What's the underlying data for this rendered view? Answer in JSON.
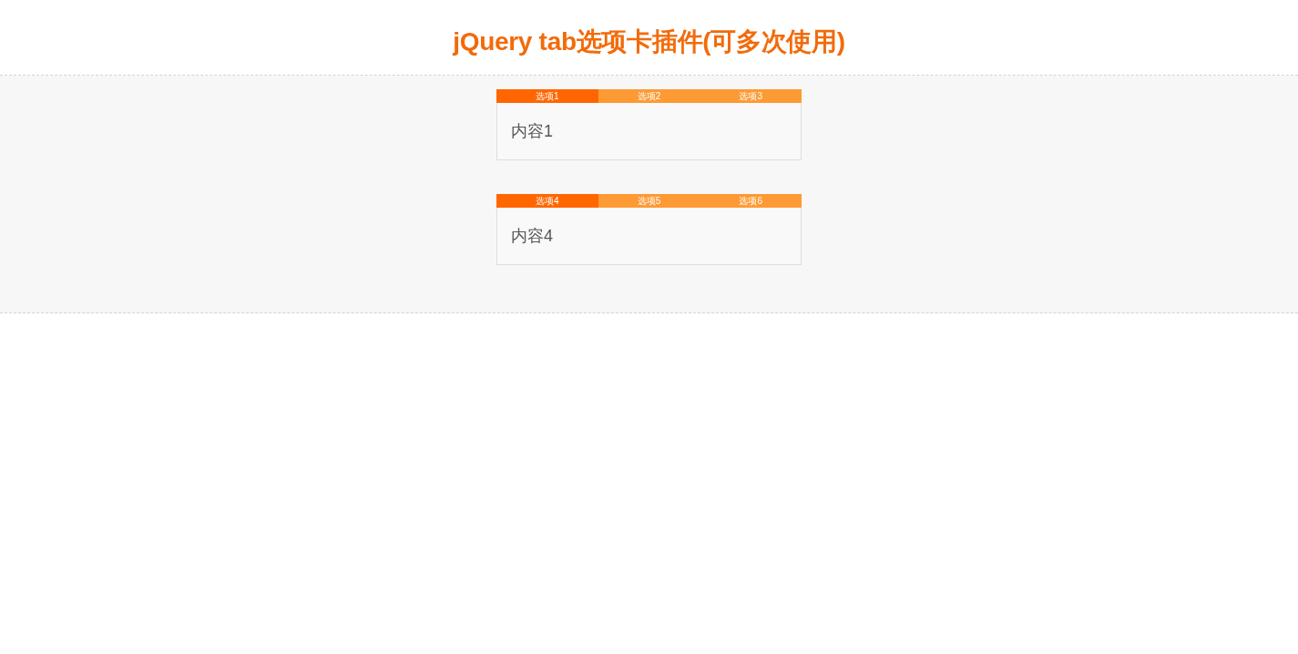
{
  "title": "jQuery tab选项卡插件(可多次使用)",
  "tab_groups": [
    {
      "tabs": [
        {
          "label": "选项1",
          "selected": true
        },
        {
          "label": "选项2",
          "selected": false
        },
        {
          "label": "选项3",
          "selected": false
        }
      ],
      "content": "内容1"
    },
    {
      "tabs": [
        {
          "label": "选项4",
          "selected": true
        },
        {
          "label": "选项5",
          "selected": false
        },
        {
          "label": "选项6",
          "selected": false
        }
      ],
      "content": "内容4"
    }
  ]
}
